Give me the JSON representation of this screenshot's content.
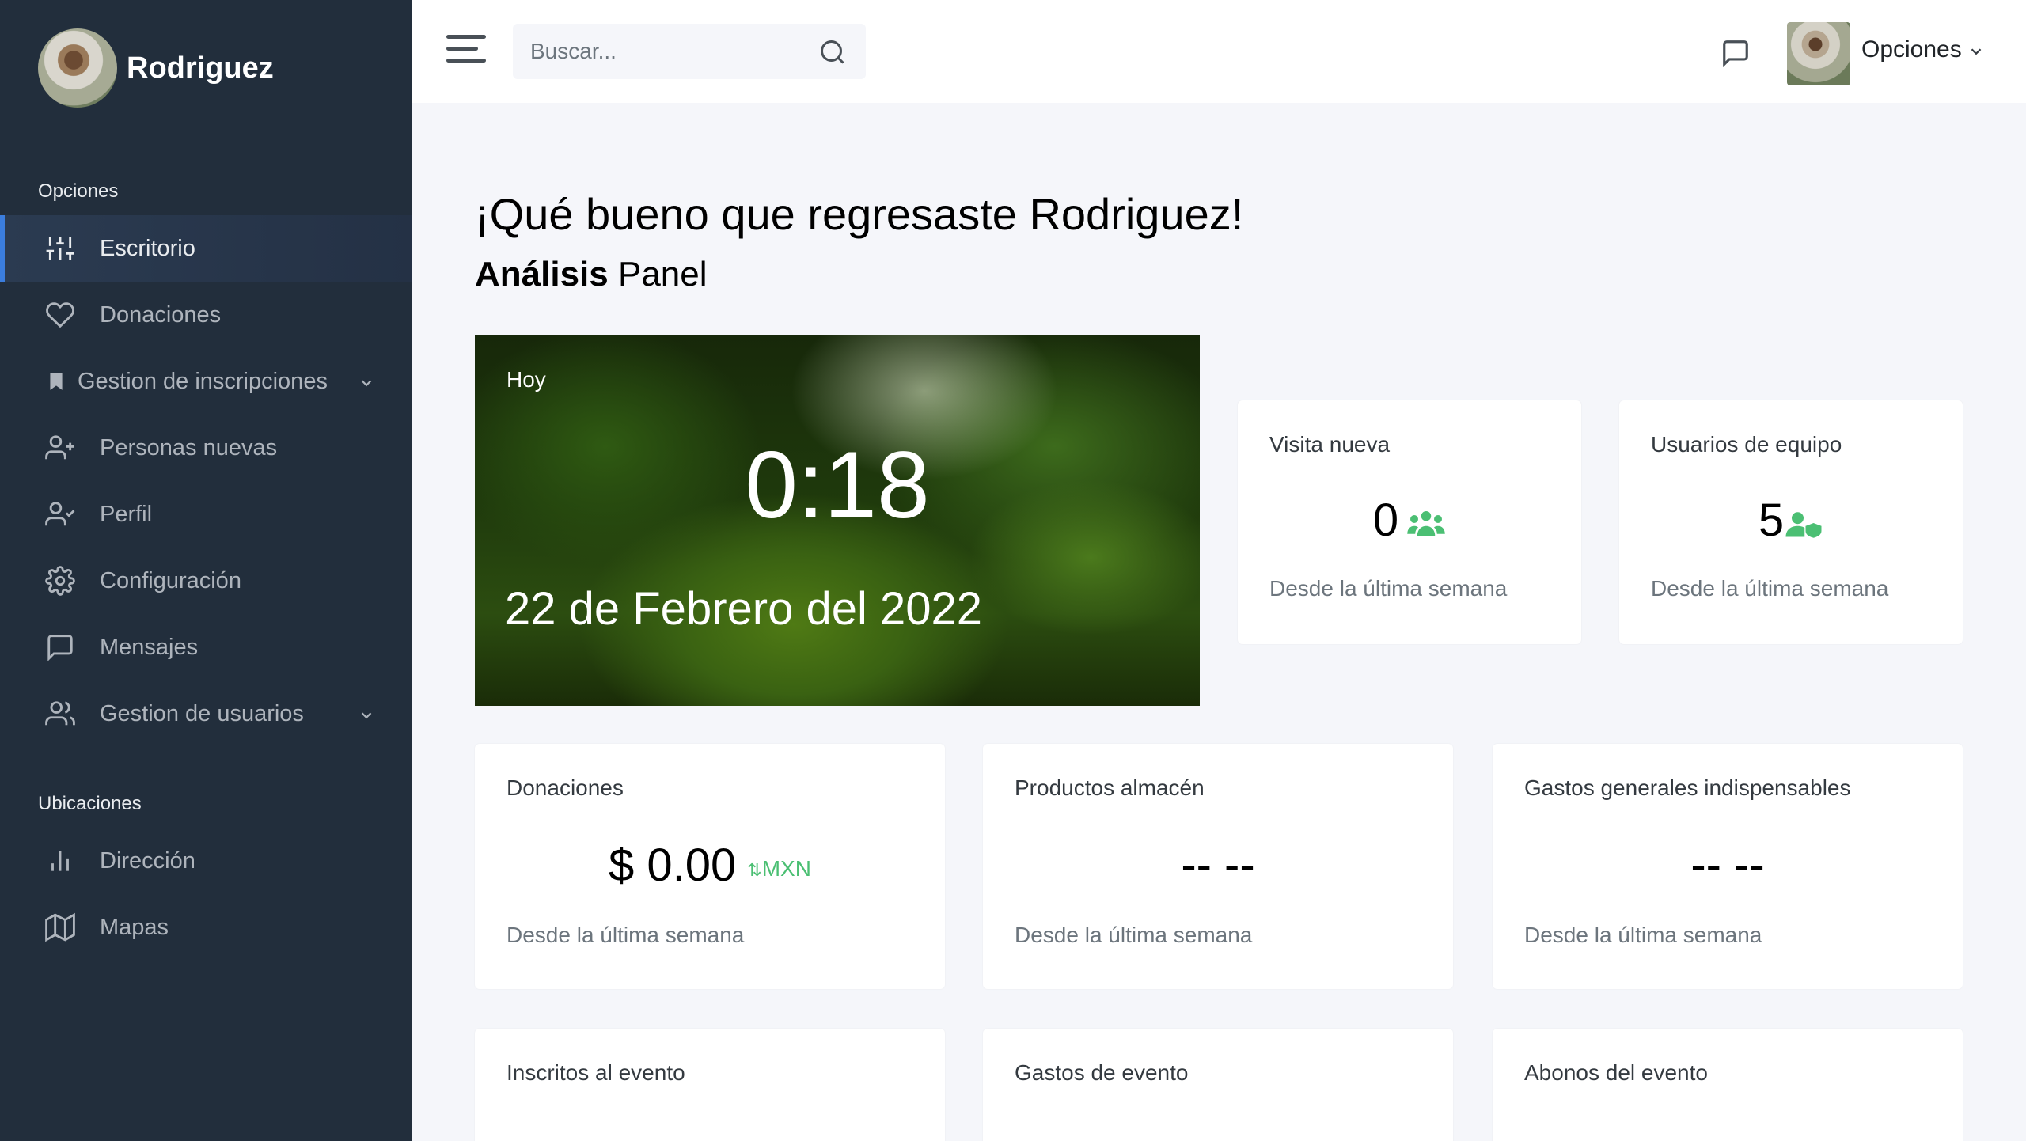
{
  "brand": {
    "name": "Rodriguez"
  },
  "sidebar": {
    "section_options": "Opciones",
    "section_locations": "Ubicaciones",
    "items": [
      {
        "label": "Escritorio",
        "icon": "sliders-icon",
        "active": true
      },
      {
        "label": "Donaciones",
        "icon": "heart-icon"
      },
      {
        "label": "Gestion de inscripciones",
        "icon": "bookmark-icon",
        "expandable": true
      },
      {
        "label": "Personas nuevas",
        "icon": "user-plus-icon"
      },
      {
        "label": "Perfil",
        "icon": "user-check-icon"
      },
      {
        "label": "Configuración",
        "icon": "gear-icon"
      },
      {
        "label": "Mensajes",
        "icon": "message-square-icon"
      },
      {
        "label": "Gestion de usuarios",
        "icon": "users-icon",
        "expandable": true
      }
    ],
    "location_items": [
      {
        "label": "Dirección",
        "icon": "bar-chart-icon"
      },
      {
        "label": "Mapas",
        "icon": "map-icon"
      }
    ]
  },
  "topbar": {
    "search_placeholder": "Buscar...",
    "user_label": "Opciones"
  },
  "main": {
    "greeting": "¡Qué bueno que regresaste Rodriguez!",
    "subtitle_bold": "Análisis",
    "subtitle_rest": " Panel",
    "hero": {
      "today": "Hoy",
      "time": "0:18",
      "date": "22 de Febrero del 2022"
    },
    "cards": [
      {
        "title": "Visita nueva",
        "value": "0",
        "icon": "users-icon",
        "footer": "Desde la última semana"
      },
      {
        "title": "Usuarios de equipo",
        "value": "5",
        "icon": "user-shield-icon",
        "footer": "Desde la última semana"
      },
      {
        "title": "Donaciones",
        "value": "$ 0.00",
        "currency": "MXN",
        "currency_icon": "exchange-arrows-icon",
        "footer": "Desde la última semana"
      },
      {
        "title": "Productos almacén",
        "value": "-- --",
        "footer": "Desde la última semana"
      },
      {
        "title": "Gastos generales indispensables",
        "value": "-- --",
        "footer": "Desde la última semana"
      },
      {
        "title": "Inscritos al evento"
      },
      {
        "title": "Gastos de evento"
      },
      {
        "title": "Abonos del evento"
      }
    ]
  },
  "colors": {
    "sidebar": "#222e3c",
    "accent": "#3b7ddd",
    "success": "#4bbf73",
    "background": "#f5f6fa"
  }
}
